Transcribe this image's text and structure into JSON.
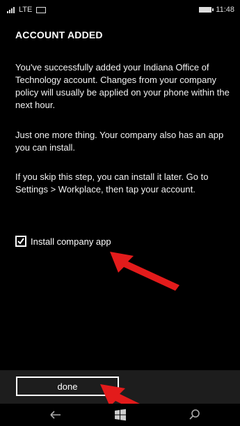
{
  "status_bar": {
    "network": "LTE",
    "time": "11:48"
  },
  "screen": {
    "title": "ACCOUNT ADDED",
    "paragraphs": [
      "You've successfully added your Indiana Office of Technology account. Changes from your company policy will usually be applied on your phone within the next hour.",
      "Just one more thing. Your company also has an app you can install.",
      "If you skip this step, you can install it later. Go to Settings > Workplace, then tap your account."
    ],
    "checkbox": {
      "label": "Install company app",
      "checked": true
    }
  },
  "app_bar": {
    "done_label": "done"
  },
  "nav_bar": {
    "icons": [
      "back-icon",
      "windows-start-icon",
      "search-icon"
    ]
  },
  "colors": {
    "background": "#000000",
    "app_bar": "#1d1d1d",
    "arrow": "#e31b1b",
    "text": "#ffffff"
  }
}
